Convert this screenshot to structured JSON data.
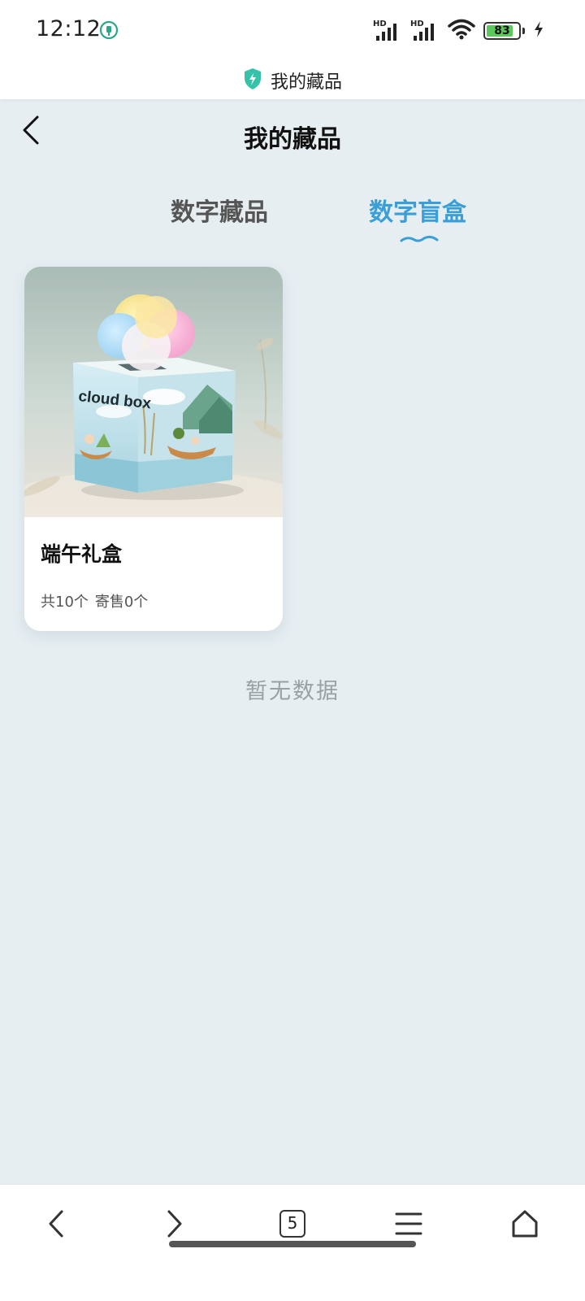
{
  "status_bar": {
    "time": "12:12",
    "signal_label_1": "HD",
    "signal_label_2": "HD",
    "battery_level": "83"
  },
  "browser": {
    "page_title": "我的藏品"
  },
  "header": {
    "title": "我的藏品"
  },
  "tabs": [
    {
      "label": "数字藏品",
      "active": false
    },
    {
      "label": "数字盲盒",
      "active": true
    }
  ],
  "items": [
    {
      "title": "端午礼盒",
      "image_text": "cloud box",
      "total": "共10个",
      "consign": "寄售0个"
    }
  ],
  "empty_text": "暂无数据",
  "bottom_nav": {
    "tabs_count": "5"
  },
  "colors": {
    "accent": "#3a9fd8",
    "background": "#e6eef2",
    "battery": "#5ac85a"
  }
}
